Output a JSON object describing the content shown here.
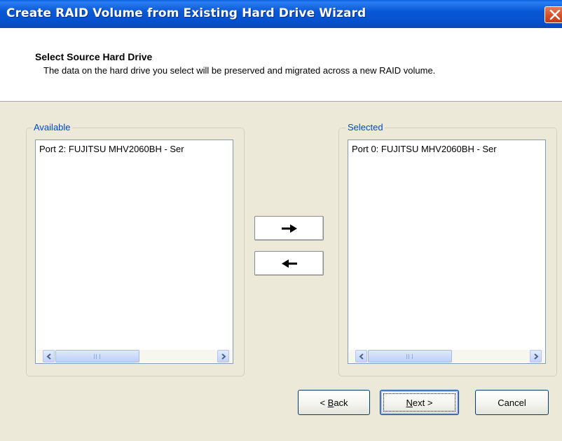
{
  "window": {
    "title": "Create RAID Volume from Existing Hard Drive Wizard"
  },
  "header": {
    "title": "Select Source Hard Drive",
    "description": "The data on the hard drive you select will be preserved and migrated across a new RAID volume."
  },
  "available": {
    "label": "Available",
    "items": [
      "Port 2: FUJITSU MHV2060BH - Ser"
    ]
  },
  "selected": {
    "label": "Selected",
    "items": [
      "Port 0: FUJITSU MHV2060BH - Ser"
    ]
  },
  "move_buttons": {
    "add_icon": "arrow-right-icon",
    "remove_icon": "arrow-left-icon"
  },
  "footer": {
    "back_prefix": "< ",
    "back_underline": "B",
    "back_rest": "ack",
    "next_underline": "N",
    "next_rest": "ext >",
    "cancel": "Cancel"
  },
  "colors": {
    "titlebar": "#0a58d6",
    "dialog_bg": "#ece9d8",
    "group_label": "#0046d5"
  }
}
